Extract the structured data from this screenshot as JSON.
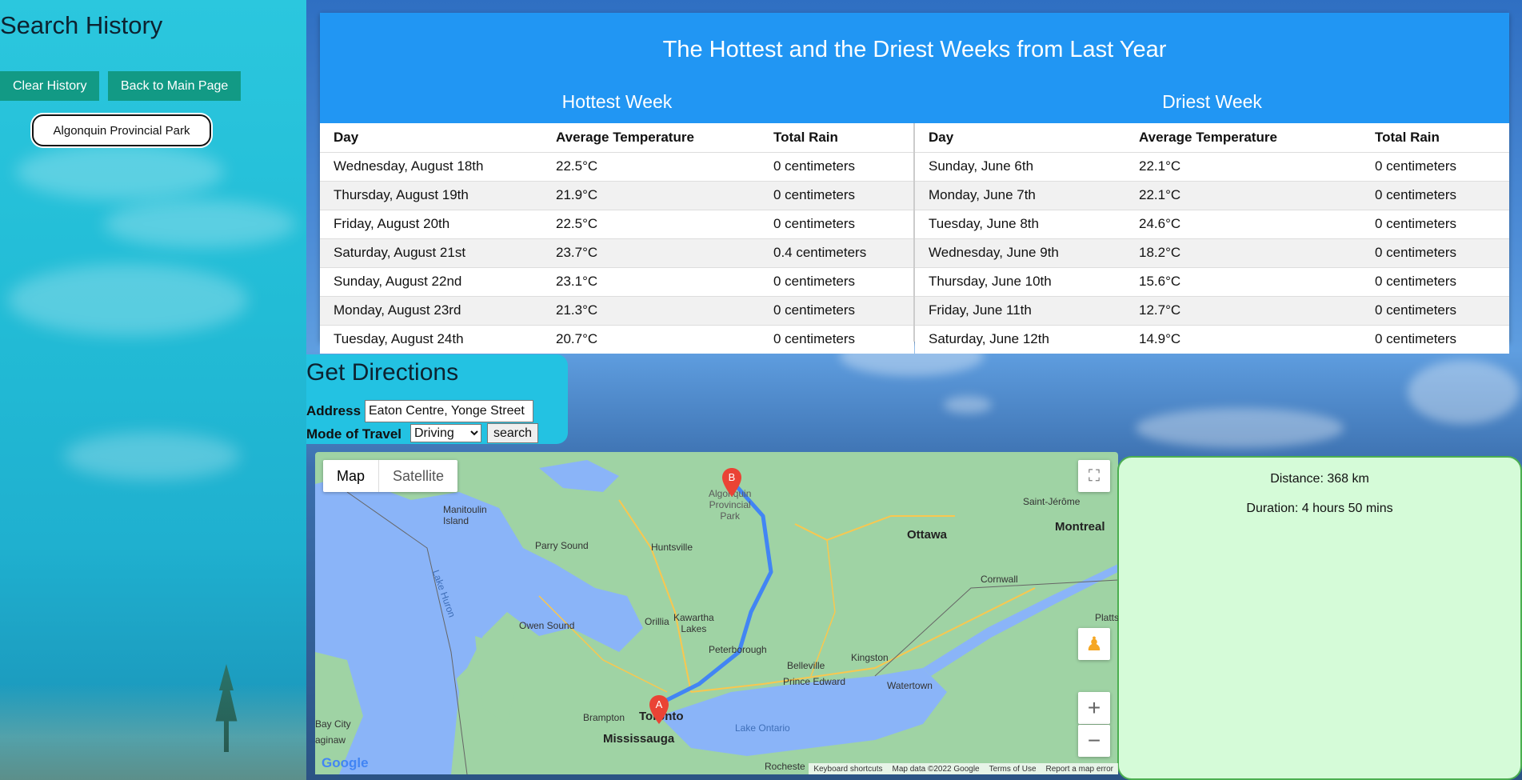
{
  "sidebar": {
    "title": "Search History",
    "clear_history_label": "Clear History",
    "back_label": "Back to Main Page",
    "history_items": [
      "Algonquin Provincial Park"
    ]
  },
  "weather": {
    "title": "The Hottest and the Driest Weeks from Last Year",
    "hottest": {
      "heading": "Hottest Week",
      "columns": [
        "Day",
        "Average Temperature",
        "Total Rain"
      ],
      "rows": [
        [
          "Wednesday, August 18th",
          "22.5°C",
          "0 centimeters"
        ],
        [
          "Thursday, August 19th",
          "21.9°C",
          "0 centimeters"
        ],
        [
          "Friday, August 20th",
          "22.5°C",
          "0 centimeters"
        ],
        [
          "Saturday, August 21st",
          "23.7°C",
          "0.4 centimeters"
        ],
        [
          "Sunday, August 22nd",
          "23.1°C",
          "0 centimeters"
        ],
        [
          "Monday, August 23rd",
          "21.3°C",
          "0 centimeters"
        ],
        [
          "Tuesday, August 24th",
          "20.7°C",
          "0 centimeters"
        ]
      ]
    },
    "driest": {
      "heading": "Driest Week",
      "columns": [
        "Day",
        "Average Temperature",
        "Total Rain"
      ],
      "rows": [
        [
          "Sunday, June 6th",
          "22.1°C",
          "0 centimeters"
        ],
        [
          "Monday, June 7th",
          "22.1°C",
          "0 centimeters"
        ],
        [
          "Tuesday, June 8th",
          "24.6°C",
          "0 centimeters"
        ],
        [
          "Wednesday, June 9th",
          "18.2°C",
          "0 centimeters"
        ],
        [
          "Thursday, June 10th",
          "15.6°C",
          "0 centimeters"
        ],
        [
          "Friday, June 11th",
          "12.7°C",
          "0 centimeters"
        ],
        [
          "Saturday, June 12th",
          "14.9°C",
          "0 centimeters"
        ]
      ]
    }
  },
  "directions": {
    "title": "Get Directions",
    "address_label": "Address",
    "address_value": "Eaton Centre, Yonge Street",
    "mode_label": "Mode of Travel",
    "mode_value": "Driving",
    "search_label": "search"
  },
  "map": {
    "tabs": [
      "Map",
      "Satellite"
    ],
    "places": {
      "manitoulin": "Manitoulin\nIsland",
      "algonquin": "Algonquin\nProvincial\nPark",
      "saint_jerome": "Saint-Jérôme",
      "ottawa": "Ottawa",
      "montreal": "Montreal",
      "parry_sound": "Parry Sound",
      "huntsville": "Huntsville",
      "cornwall": "Cornwall",
      "lake_huron": "Lake Huron",
      "orillia": "Orillia",
      "kawartha": "Kawartha\nLakes",
      "owen_sound": "Owen Sound",
      "peterborough": "Peterborough",
      "belleville": "Belleville",
      "kingston": "Kingston",
      "prince_edward": "Prince Edward",
      "watertown": "Watertown",
      "plattsburgh": "Platts",
      "brampton": "Brampton",
      "toronto": "Toronto",
      "mississauga": "Mississauga",
      "bay_city": "Bay City",
      "saginaw": "aginaw",
      "lake_ontario": "Lake Ontario",
      "rochester": "Rocheste"
    },
    "markers": {
      "origin": "A",
      "destination": "B"
    },
    "footer": [
      "Keyboard shortcuts",
      "Map data ©2022 Google",
      "Terms of Use",
      "Report a map error"
    ],
    "logo": "Google"
  },
  "route": {
    "distance": "Distance: 368 km",
    "duration": "Duration: 4 hours 50 mins"
  },
  "colors": {
    "header_blue": "#2196f3",
    "teal_button": "#129a85",
    "sidebar_cyan": "#23c2e2",
    "panel_green": "#d5fbd8",
    "route_blue": "#4285f4",
    "marker_red": "#ea4335"
  }
}
